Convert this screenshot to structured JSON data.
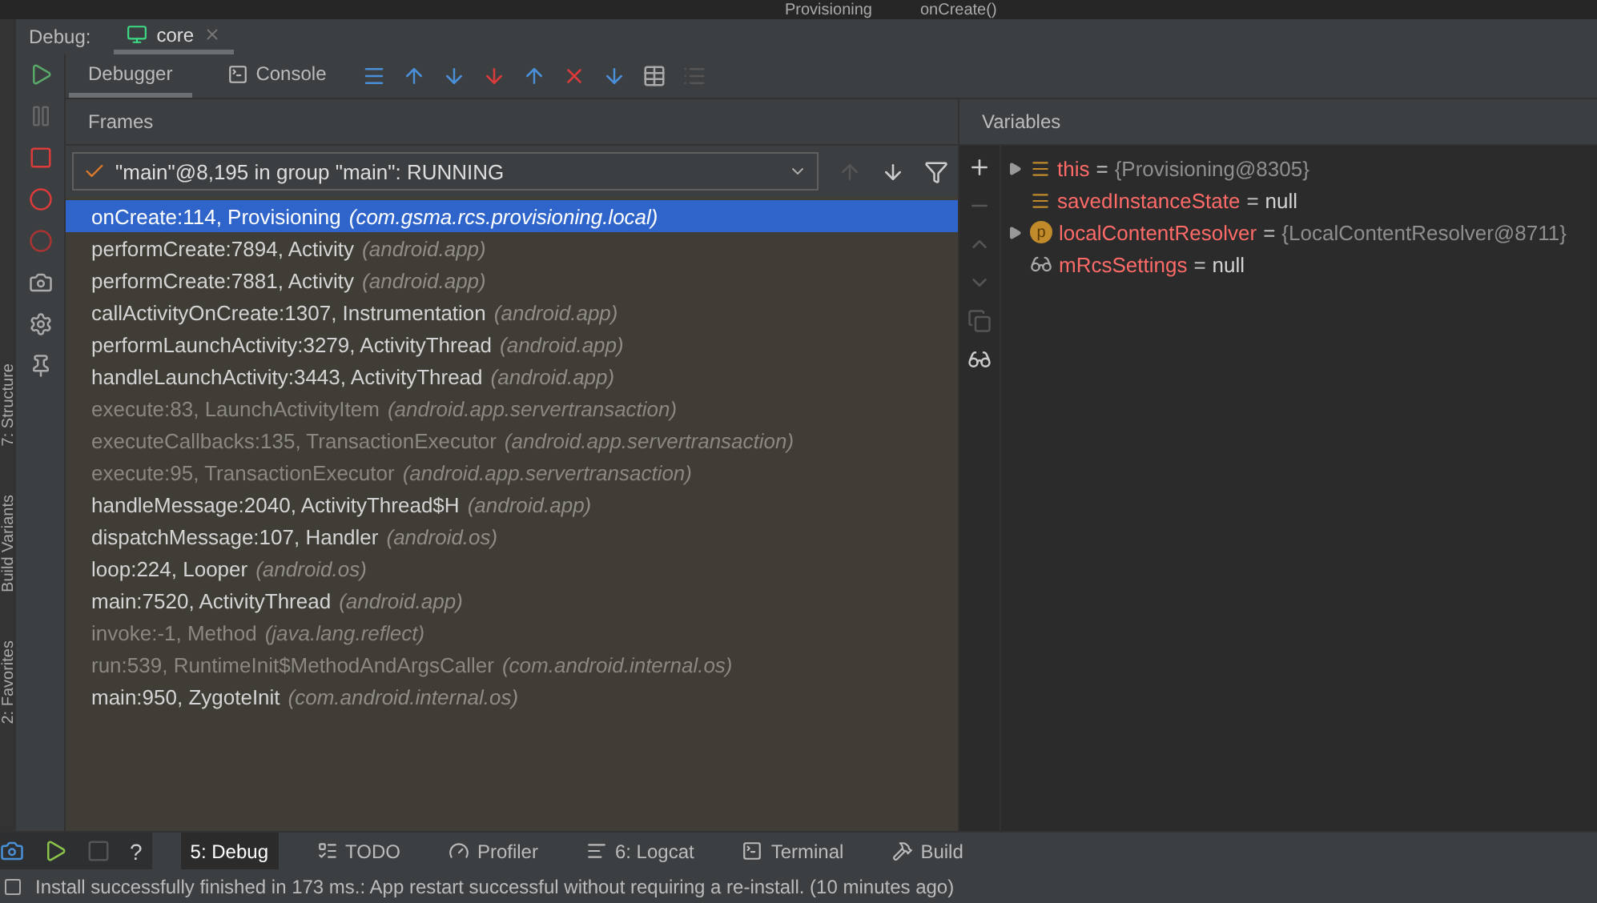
{
  "breadcrumb": [
    "Provisioning",
    "onCreate()"
  ],
  "debug_header": {
    "label": "Debug:",
    "session": "core"
  },
  "tabs": [
    {
      "label": "Debugger",
      "selected": true
    },
    {
      "label": "Console",
      "selected": false
    }
  ],
  "frames": {
    "title": "Frames",
    "thread": "\"main\"@8,195 in group \"main\": RUNNING",
    "rows": [
      {
        "method": "onCreate:114, Provisioning",
        "package": "(com.gsma.rcs.provisioning.local)",
        "library": false,
        "selected": true
      },
      {
        "method": "performCreate:7894, Activity",
        "package": "(android.app)",
        "library": false,
        "selected": false
      },
      {
        "method": "performCreate:7881, Activity",
        "package": "(android.app)",
        "library": false,
        "selected": false
      },
      {
        "method": "callActivityOnCreate:1307, Instrumentation",
        "package": "(android.app)",
        "library": false,
        "selected": false
      },
      {
        "method": "performLaunchActivity:3279, ActivityThread",
        "package": "(android.app)",
        "library": false,
        "selected": false
      },
      {
        "method": "handleLaunchActivity:3443, ActivityThread",
        "package": "(android.app)",
        "library": false,
        "selected": false
      },
      {
        "method": "execute:83, LaunchActivityItem",
        "package": "(android.app.servertransaction)",
        "library": true,
        "selected": false
      },
      {
        "method": "executeCallbacks:135, TransactionExecutor",
        "package": "(android.app.servertransaction)",
        "library": true,
        "selected": false
      },
      {
        "method": "execute:95, TransactionExecutor",
        "package": "(android.app.servertransaction)",
        "library": true,
        "selected": false
      },
      {
        "method": "handleMessage:2040, ActivityThread$H",
        "package": "(android.app)",
        "library": false,
        "selected": false
      },
      {
        "method": "dispatchMessage:107, Handler",
        "package": "(android.os)",
        "library": false,
        "selected": false
      },
      {
        "method": "loop:224, Looper",
        "package": "(android.os)",
        "library": false,
        "selected": false
      },
      {
        "method": "main:7520, ActivityThread",
        "package": "(android.app)",
        "library": false,
        "selected": false
      },
      {
        "method": "invoke:-1, Method",
        "package": "(java.lang.reflect)",
        "library": true,
        "selected": false
      },
      {
        "method": "run:539, RuntimeInit$MethodAndArgsCaller",
        "package": "(com.android.internal.os)",
        "library": true,
        "selected": false
      },
      {
        "method": "main:950, ZygoteInit",
        "package": "(com.android.internal.os)",
        "library": false,
        "selected": false
      }
    ]
  },
  "variables": {
    "title": "Variables",
    "items": [
      {
        "kind": "field",
        "name": "this",
        "op": "=",
        "value": "{Provisioning@8305}",
        "object": true,
        "expandable": true
      },
      {
        "kind": "field",
        "name": "savedInstanceState",
        "op": "=",
        "value": "null",
        "object": false,
        "expandable": false
      },
      {
        "kind": "parameter",
        "icon_letter": "p",
        "name": "localContentResolver",
        "op": "=",
        "value": "{LocalContentResolver@8711}",
        "object": true,
        "expandable": true
      },
      {
        "kind": "watch",
        "name": "mRcsSettings",
        "op": "=",
        "value": "null",
        "object": false,
        "expandable": false
      }
    ]
  },
  "side_tabs": [
    "7: Structure",
    "Build Variants",
    "2: Favorites"
  ],
  "overlay_help": "?",
  "bottom_tabs": [
    {
      "label": "5: Debug",
      "selected": true
    },
    {
      "label": "TODO",
      "selected": false
    },
    {
      "label": "Profiler",
      "selected": false
    },
    {
      "label": "6: Logcat",
      "selected": false
    },
    {
      "label": "Terminal",
      "selected": false
    },
    {
      "label": "Build",
      "selected": false
    }
  ],
  "status": "Install successfully finished in 173 ms.: App restart successful without requiring a re-install. (10 minutes ago)"
}
